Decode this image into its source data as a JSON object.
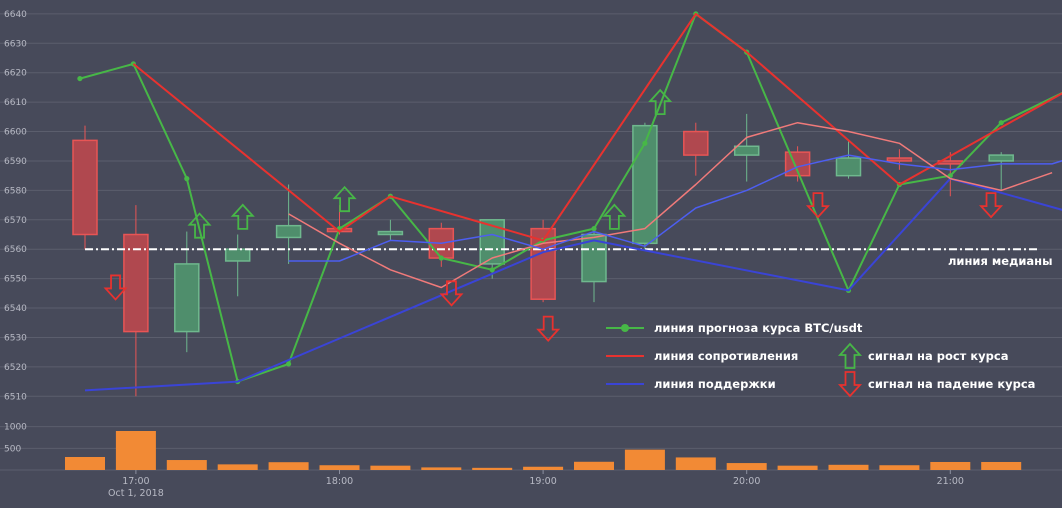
{
  "chart_data": {
    "type": "candlestick",
    "y_range": [
      6505,
      6642
    ],
    "y_ticks": [
      6510,
      6520,
      6530,
      6540,
      6550,
      6560,
      6570,
      6580,
      6590,
      6600,
      6610,
      6620,
      6630,
      6640
    ],
    "x_range": [
      0,
      20.1
    ],
    "x_ticks": [
      {
        "x": 1,
        "label": "17:00",
        "sublabel": "Oct 1, 2018"
      },
      {
        "x": 5,
        "label": "18:00",
        "sublabel": ""
      },
      {
        "x": 9,
        "label": "19:00",
        "sublabel": ""
      },
      {
        "x": 13,
        "label": "20:00",
        "sublabel": ""
      },
      {
        "x": 17,
        "label": "21:00",
        "sublabel": ""
      }
    ],
    "candles": [
      {
        "open": 6597,
        "close": 6565,
        "high": 6602,
        "low": 6560
      },
      {
        "open": 6565,
        "close": 6532,
        "high": 6575,
        "low": 6510
      },
      {
        "open": 6532,
        "close": 6555,
        "high": 6566,
        "low": 6525
      },
      {
        "open": 6556,
        "close": 6560,
        "high": 6565,
        "low": 6544
      },
      {
        "open": 6564,
        "close": 6568,
        "high": 6582,
        "low": 6555
      },
      {
        "open": 6567,
        "close": 6566,
        "high": 6575,
        "low": 6565
      },
      {
        "open": 6565,
        "close": 6566,
        "high": 6570,
        "low": 6563
      },
      {
        "open": 6567,
        "close": 6557,
        "high": 6569,
        "low": 6554
      },
      {
        "open": 6555,
        "close": 6570,
        "high": 6570,
        "low": 6550
      },
      {
        "open": 6567,
        "close": 6543,
        "high": 6570,
        "low": 6542
      },
      {
        "open": 6549,
        "close": 6565,
        "high": 6566,
        "low": 6542
      },
      {
        "open": 6562,
        "close": 6602,
        "high": 6603,
        "low": 6560
      },
      {
        "open": 6600,
        "close": 6592,
        "high": 6603,
        "low": 6585
      },
      {
        "open": 6592,
        "close": 6595,
        "high": 6606,
        "low": 6583
      },
      {
        "open": 6593,
        "close": 6585,
        "high": 6595,
        "low": 6583
      },
      {
        "open": 6585,
        "close": 6591,
        "high": 6597,
        "low": 6584
      },
      {
        "open": 6591,
        "close": 6590,
        "high": 6594,
        "low": 6587
      },
      {
        "open": 6590,
        "close": 6589,
        "high": 6593,
        "low": 6578
      },
      {
        "open": 6590,
        "close": 6592,
        "high": 6593,
        "low": 6580
      }
    ],
    "volume_ticks": [
      "1000",
      "500"
    ],
    "volumes": [
      300,
      900,
      230,
      130,
      180,
      110,
      100,
      60,
      50,
      75,
      190,
      470,
      290,
      160,
      100,
      120,
      110,
      185,
      185
    ],
    "volume_max": 1200,
    "median_value": 6560,
    "median_label": "линия медианы",
    "series": [
      {
        "name": "линия прогноза курса BTC/usdt",
        "color": "#47b747",
        "markers": true,
        "points": [
          [
            -0.1,
            6618
          ],
          [
            0.95,
            6623
          ],
          [
            2.0,
            6584
          ],
          [
            3.0,
            6515
          ],
          [
            4.0,
            6521
          ],
          [
            5.0,
            6567
          ],
          [
            6.0,
            6578
          ],
          [
            7.0,
            6557
          ],
          [
            8.0,
            6553
          ],
          [
            9.0,
            6563
          ],
          [
            10.0,
            6567
          ],
          [
            11.0,
            6596
          ],
          [
            12.0,
            6640
          ],
          [
            13.0,
            6627
          ],
          [
            15.0,
            6546
          ],
          [
            16.0,
            6582
          ],
          [
            17.0,
            6585
          ],
          [
            18.0,
            6603
          ],
          [
            19.3,
            6614
          ]
        ]
      },
      {
        "name": "линия сопротивления",
        "color": "#e8322f",
        "markers": false,
        "points": [
          [
            0.95,
            6623
          ],
          [
            5.0,
            6566
          ],
          [
            6.0,
            6578
          ],
          [
            9.0,
            6563
          ],
          [
            12.0,
            6640
          ],
          [
            13.0,
            6627
          ],
          [
            16.0,
            6582
          ],
          [
            19.3,
            6614
          ]
        ]
      },
      {
        "name": "линия поддержки",
        "color": "#3a44d6",
        "markers": false,
        "points": [
          [
            0,
            6512
          ],
          [
            3.0,
            6515
          ],
          [
            9.0,
            6559
          ],
          [
            10.0,
            6563
          ],
          [
            15.0,
            6546
          ],
          [
            17.0,
            6584
          ],
          [
            20.1,
            6569
          ]
        ]
      },
      {
        "name": "",
        "color": "#f07a7a",
        "markers": false,
        "points": [
          [
            4.0,
            6572
          ],
          [
            5.0,
            6562
          ],
          [
            6.0,
            6553
          ],
          [
            7.0,
            6547
          ],
          [
            8.0,
            6557
          ],
          [
            9.0,
            6562
          ],
          [
            10.0,
            6564
          ],
          [
            11.0,
            6567
          ],
          [
            12.0,
            6582
          ],
          [
            13.0,
            6598
          ],
          [
            14.0,
            6603
          ],
          [
            15.0,
            6600
          ],
          [
            16.0,
            6596
          ],
          [
            17.0,
            6584
          ],
          [
            18.0,
            6580
          ],
          [
            19.0,
            6586
          ]
        ]
      },
      {
        "name": "",
        "color": "#4d5ef0",
        "markers": false,
        "points": [
          [
            4.0,
            6556
          ],
          [
            5.0,
            6556
          ],
          [
            6.0,
            6563
          ],
          [
            7.0,
            6562
          ],
          [
            8.0,
            6565
          ],
          [
            9.0,
            6560
          ],
          [
            10.0,
            6566
          ],
          [
            11.0,
            6561
          ],
          [
            12.0,
            6574
          ],
          [
            13.0,
            6580
          ],
          [
            14.0,
            6588
          ],
          [
            15.0,
            6592
          ],
          [
            16.0,
            6589
          ],
          [
            17.0,
            6587
          ],
          [
            18.0,
            6589
          ],
          [
            19.0,
            6589
          ],
          [
            20.1,
            6595
          ]
        ]
      }
    ],
    "signals": [
      {
        "x": 0.6,
        "value": 6547,
        "dir": "down"
      },
      {
        "x": 2.25,
        "value": 6568,
        "dir": "up"
      },
      {
        "x": 3.1,
        "value": 6571,
        "dir": "up"
      },
      {
        "x": 5.1,
        "value": 6577,
        "dir": "up"
      },
      {
        "x": 7.2,
        "value": 6545,
        "dir": "down"
      },
      {
        "x": 9.1,
        "value": 6533,
        "dir": "down"
      },
      {
        "x": 10.4,
        "value": 6571,
        "dir": "up"
      },
      {
        "x": 11.3,
        "value": 6610,
        "dir": "up"
      },
      {
        "x": 14.4,
        "value": 6575,
        "dir": "down"
      },
      {
        "x": 17.8,
        "value": 6575,
        "dir": "down"
      }
    ],
    "legend": [
      {
        "label": "линия прогноза курса BTC/usdt",
        "kind": "marker-line",
        "color": "#47b747"
      },
      {
        "label": "линия сопротивления",
        "kind": "line",
        "color": "#e8322f"
      },
      {
        "label": "линия поддержки",
        "kind": "line",
        "color": "#3a44d6"
      },
      {
        "label": "сигнал на рост курса",
        "kind": "up-arrow",
        "color": "#47b747"
      },
      {
        "label": "сигнал на падение курса",
        "kind": "down-arrow",
        "color": "#e8322f"
      }
    ],
    "colors": {
      "background": "#474a5a",
      "grid": "#5b5e6d",
      "bull_fill": "#4f8e6c",
      "bull_stroke": "#6fb88e",
      "bear_fill": "#b0484f",
      "bear_stroke": "#e85555",
      "volume": "#f28a35",
      "median": "#ffffff"
    }
  }
}
